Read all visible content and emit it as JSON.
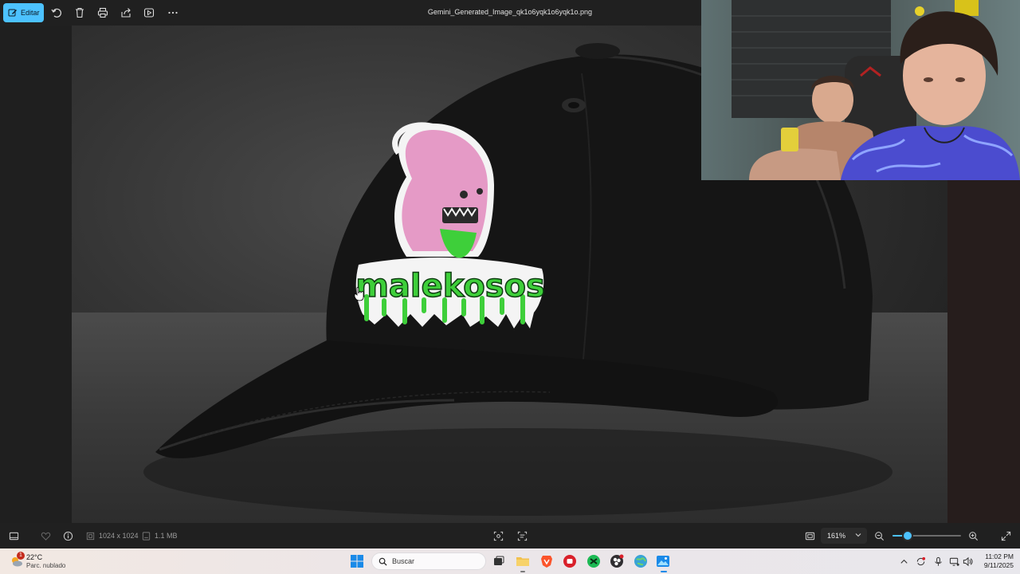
{
  "toolbar": {
    "edit_label": "Editar",
    "file_name": "Gemini_Generated_Image_qk1o6yqk1o6yqk1o.png"
  },
  "image": {
    "logo_text": "malekosos"
  },
  "statusbar": {
    "dimensions": "1024 x 1024",
    "file_size": "1.1 MB",
    "zoom": "161%",
    "zoom_slider_level_percent": 22
  },
  "taskbar": {
    "weather_temp": "22°C",
    "weather_condition": "Parc. nublado",
    "weather_badge": "1",
    "search_placeholder": "Buscar",
    "time": "11:02 PM",
    "date": "9/11/2025"
  },
  "colors": {
    "accent": "#4cc2ff",
    "logo_green": "#3ecf3a",
    "logo_pink": "#e79ac7"
  }
}
